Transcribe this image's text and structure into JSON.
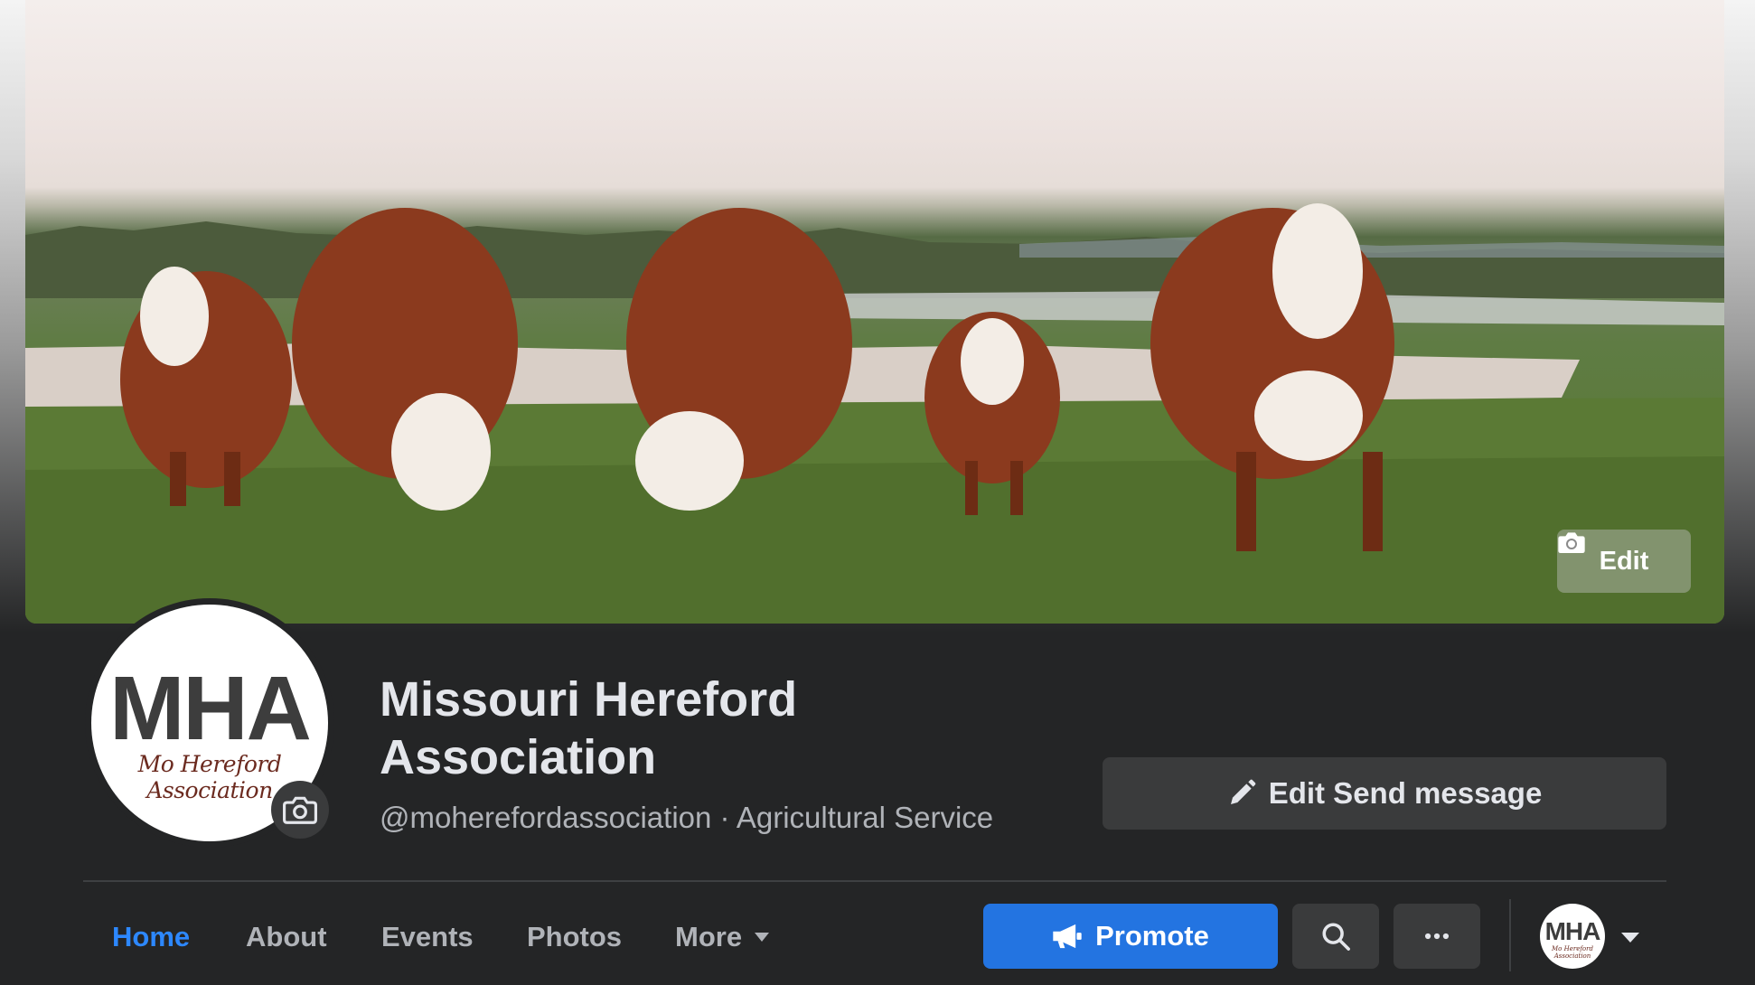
{
  "cover": {
    "edit_label": "Edit"
  },
  "profile": {
    "avatar_initials": "MHA",
    "avatar_script": "Mo Hereford Association",
    "name": "Missouri Hereford Association",
    "meta": "@moherefordassociation · Agricultural Service"
  },
  "actions": {
    "edit_send_label": "Edit Send message"
  },
  "tabs": [
    {
      "label": "Home",
      "active": true
    },
    {
      "label": "About",
      "active": false
    },
    {
      "label": "Events",
      "active": false
    },
    {
      "label": "Photos",
      "active": false
    },
    {
      "label": "More",
      "active": false
    }
  ],
  "toolbar": {
    "promote_label": "Promote",
    "search_icon": "search-icon",
    "more_icon": "ellipsis-icon"
  },
  "account": {
    "initials": "MHA",
    "script": "Mo Hereford Association"
  },
  "colors": {
    "background": "#242526",
    "accent": "#2d88ff",
    "promote": "#2374e1",
    "button": "#3a3b3c",
    "text_primary": "#e4e6eb",
    "text_secondary": "#b0b3b8"
  }
}
